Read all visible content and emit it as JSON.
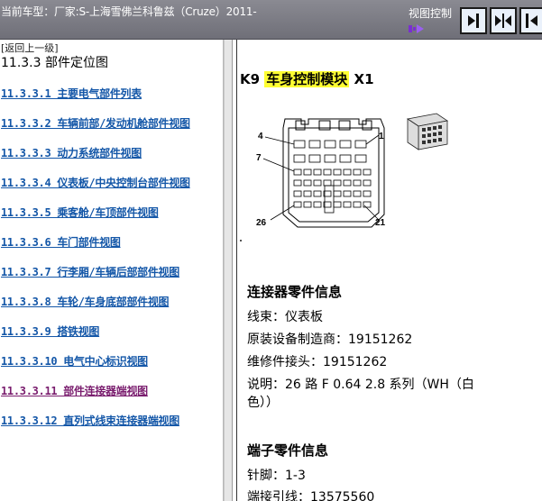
{
  "header": {
    "car_title": "当前车型：厂家:S-上海雪佛兰科鲁兹（Cruze）2011-",
    "view_control_label": "视图控制"
  },
  "toolbar": {
    "buttons": [
      {
        "name": "collapse-left-pane",
        "icon": "arrow-right-bar-icon"
      },
      {
        "name": "restore-split",
        "icon": "arrows-inward-icon"
      },
      {
        "name": "expand-left-pane",
        "icon": "arrow-left-bar-icon"
      }
    ]
  },
  "sidebar": {
    "back_link": "[返回上一级]",
    "section_title": "11.3.3 部件定位图",
    "items": [
      {
        "label": "11.3.3.1 主要电气部件列表",
        "active": false
      },
      {
        "label": "11.3.3.2 车辆前部/发动机舱部件视图",
        "active": false
      },
      {
        "label": "11.3.3.3 动力系统部件视图",
        "active": false
      },
      {
        "label": "11.3.3.4 仪表板/中央控制台部件视图",
        "active": false
      },
      {
        "label": "11.3.3.5 乘客舱/车顶部件视图",
        "active": false
      },
      {
        "label": "11.3.3.6 车门部件视图",
        "active": false
      },
      {
        "label": "11.3.3.7 行李厢/车辆后部部件视图",
        "active": false
      },
      {
        "label": "11.3.3.8 车轮/车身底部部件视图",
        "active": false
      },
      {
        "label": "11.3.3.9 搭铁视图",
        "active": false
      },
      {
        "label": "11.3.3.10 电气中心标识视图",
        "active": false
      },
      {
        "label": "11.3.3.11 部件连接器端视图",
        "active": true
      },
      {
        "label": "11.3.3.12 直列式线束连接器端视图",
        "active": false
      }
    ]
  },
  "document": {
    "module_id": "K9",
    "module_name": "车身控制模块",
    "connector_id": "X1",
    "pin_labels": {
      "top_left": "4",
      "top_right": "1",
      "mid_left": "7",
      "bottom_left": "26",
      "bottom_right": "21"
    },
    "connector_info": {
      "heading": "连接器零件信息",
      "harness": "线束：仪表板",
      "oem": "原装设备制造商：19151262",
      "service": "维修件接头：19151262",
      "desc_line1": "说明：26 路  F 0.64 2.8 系列（WH（白",
      "desc_line2": "色））"
    },
    "terminal_info": {
      "heading": "端子零件信息",
      "pins": "针脚：1-3",
      "terminal_lead": "端接引线：13575560"
    }
  },
  "colors": {
    "topbar": "#7a7a82",
    "link": "#1457a8",
    "active_link": "#7a1d6e",
    "highlight": "#ffff33"
  }
}
